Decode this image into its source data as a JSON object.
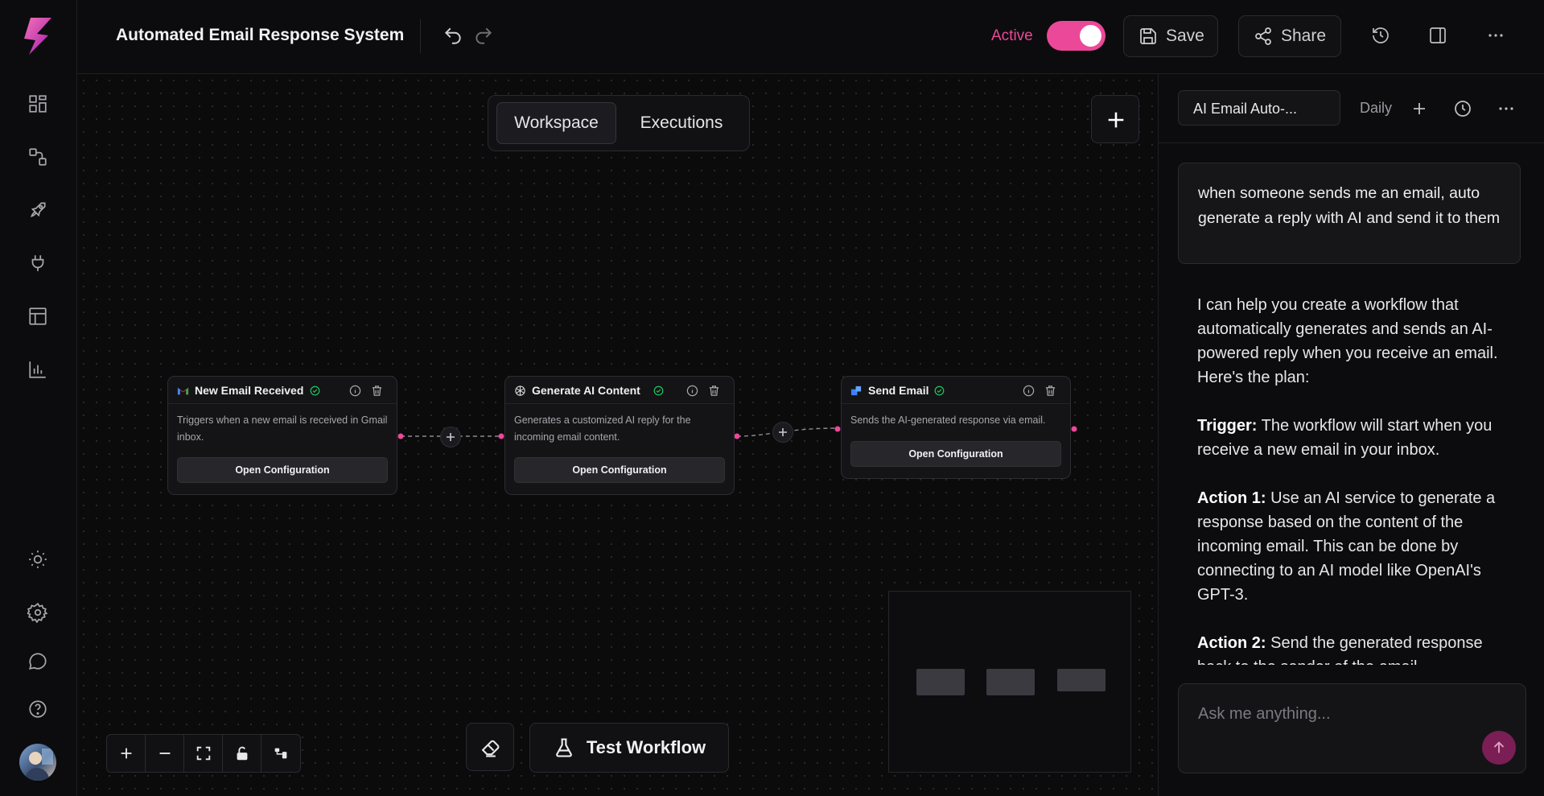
{
  "header": {
    "title": "Automated Email Response System",
    "status_label": "Active",
    "status_on": true,
    "save_label": "Save",
    "share_label": "Share"
  },
  "canvas": {
    "tabs": [
      {
        "label": "Workspace",
        "selected": true
      },
      {
        "label": "Executions",
        "selected": false
      }
    ],
    "nodes": [
      {
        "title": "New Email Received",
        "icon": "gmail-icon",
        "description": "Triggers when a new email is received in Gmail inbox.",
        "button": "Open Configuration"
      },
      {
        "title": "Generate AI Content",
        "icon": "openai-icon",
        "description": "Generates a customized AI reply for the incoming email content.",
        "button": "Open Configuration"
      },
      {
        "title": "Send Email",
        "icon": "send-email-icon",
        "description": "Sends the AI-generated response via email.",
        "button": "Open Configuration"
      }
    ],
    "test_button": "Test Workflow"
  },
  "chat": {
    "name": "AI Email Auto-...",
    "schedule": "Daily",
    "user_message": "when someone sends me an email, auto generate a reply with AI and send it to them",
    "assistant": {
      "intro": "I can help you create a workflow that automatically generates and sends an AI-powered reply when you receive an email. Here's the plan:",
      "trigger_label": "Trigger:",
      "trigger_text": " The workflow will start when you receive a new email in your inbox.",
      "action1_label": "Action 1:",
      "action1_text": " Use an AI service to generate a response based on the content of the incoming email. This can be done by connecting to an AI model like OpenAI's GPT-3.",
      "action2_label": "Action 2:",
      "action2_text": " Send the generated response back to the sender of the email."
    },
    "input_placeholder": "Ask me anything..."
  },
  "colors": {
    "accent": "#ec4899",
    "success": "#22c55e",
    "background": "#0b0b0c"
  }
}
